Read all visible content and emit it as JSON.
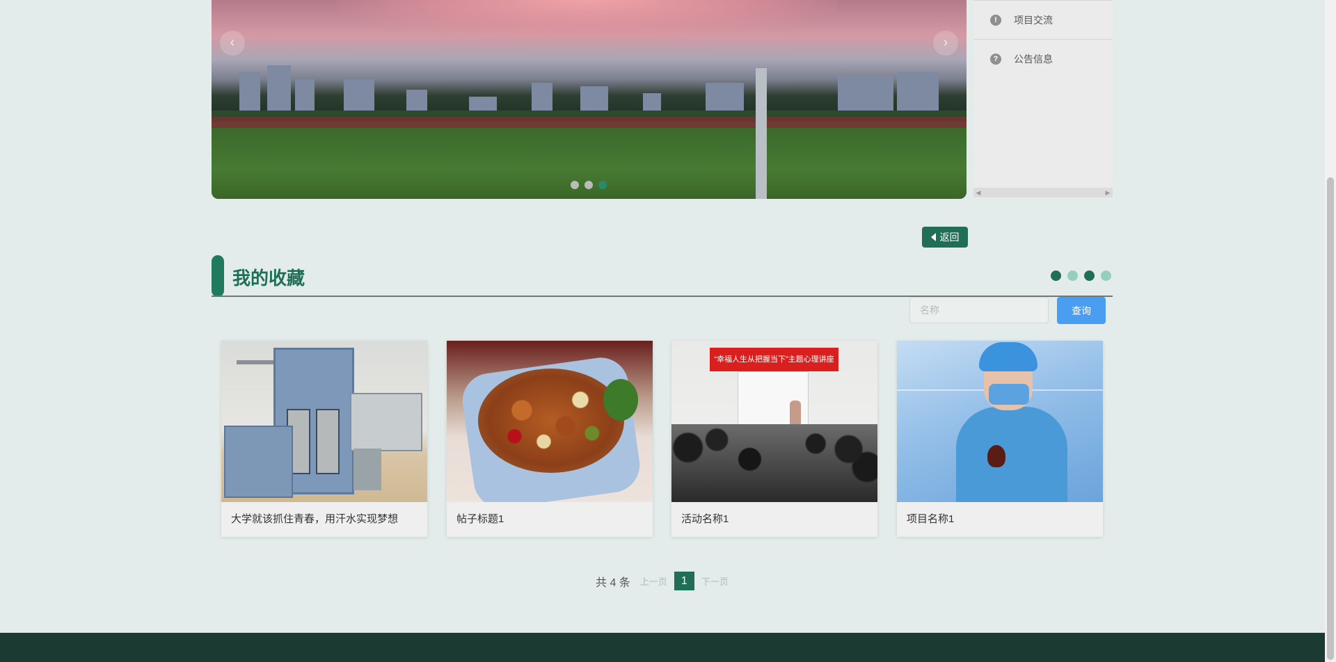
{
  "carousel": {
    "prev_icon": "‹",
    "next_icon": "›",
    "active_index": 2,
    "dot_count": 3
  },
  "side_menu": {
    "items": [
      {
        "icon": "!",
        "icon_name": "exclamation-circle-icon",
        "label": "项目交流"
      },
      {
        "icon": "?",
        "icon_name": "question-circle-icon",
        "label": "公告信息"
      }
    ]
  },
  "back_button": {
    "label": "返回"
  },
  "section": {
    "title": "我的收藏",
    "dot_colors": [
      "#1f6e55",
      "#93cfbb",
      "#1f6e55",
      "#93cfbb"
    ]
  },
  "search": {
    "placeholder": "名称",
    "value": "",
    "button_label": "查询"
  },
  "cards": [
    {
      "title": "大学就该抓住青春，用汗水实现梦想",
      "image": "lab-equipment"
    },
    {
      "title": "帖子标题1",
      "image": "kung-pao-chicken"
    },
    {
      "title": "活动名称1",
      "image": "lecture",
      "banner_text": "“幸福人生从把握当下”主题心理讲座"
    },
    {
      "title": "项目名称1",
      "image": "scientist"
    }
  ],
  "pagination": {
    "total": "共 4 条",
    "prev": "上一页",
    "current": "1",
    "next": "下一页"
  },
  "colors": {
    "accent": "#1f6e55",
    "search_button": "#4a9ef2",
    "footer": "#1b3a32",
    "background": "#e4eceb"
  }
}
